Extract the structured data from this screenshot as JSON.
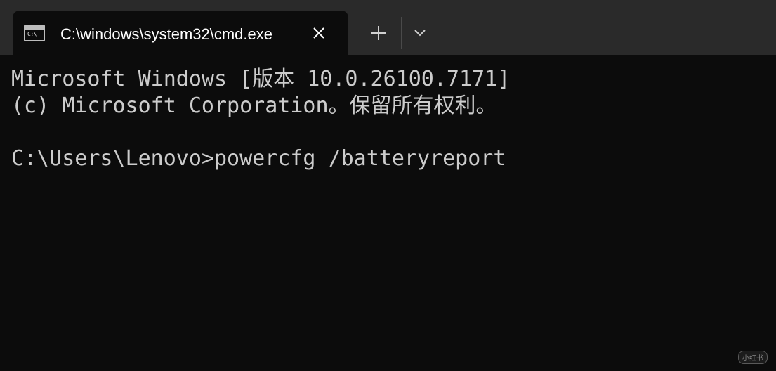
{
  "tab": {
    "title": "C:\\windows\\system32\\cmd.exe",
    "icon": "console-icon",
    "icon_text": "C:\\_"
  },
  "toolbar": {
    "close_icon": "close-icon",
    "new_tab_icon": "plus-icon",
    "dropdown_icon": "chevron-down-icon"
  },
  "console": {
    "lines": [
      "Microsoft Windows [版本 10.0.26100.7171]",
      "(c) Microsoft Corporation。保留所有权利。",
      "",
      "C:\\Users\\Lenovo>powercfg /batteryreport"
    ]
  },
  "watermark": "小红书",
  "colors": {
    "titlebar": "#2a2a2a",
    "background": "#0c0c0c",
    "text": "#cccccc"
  }
}
